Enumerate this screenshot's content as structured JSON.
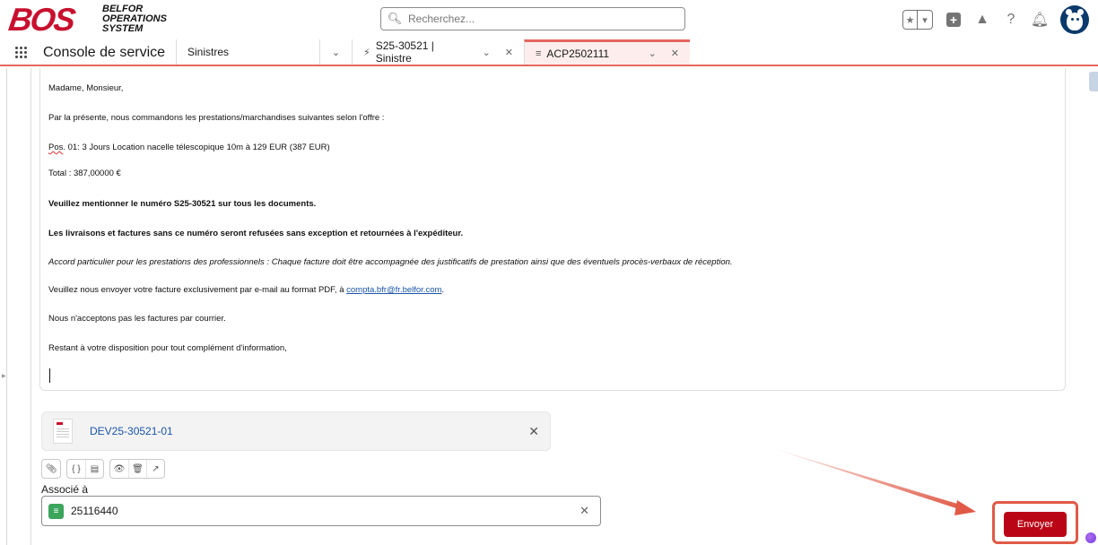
{
  "header": {
    "logo_mark": "BOS",
    "logo_text_lines": [
      "BELFOR",
      "OPERATIONS",
      "SYSTEM"
    ],
    "search_placeholder": "Recherchez...",
    "icons": [
      "favorites-icon",
      "favorites-dropdown-icon",
      "global-actions-icon",
      "trailhead-icon",
      "help-icon",
      "notifications-icon",
      "avatar"
    ]
  },
  "nav": {
    "app_name": "Console de service",
    "object_menu": "Sinistres",
    "tabs": [
      {
        "label": "S25-30521 | Sinistre",
        "icon": "lightning-icon"
      },
      {
        "label": "ACP2502111",
        "icon": "list-icon",
        "active": true
      }
    ]
  },
  "email": {
    "greeting": "Madame, Monsieur,",
    "intro": "Par la présente, nous commandons les prestations/marchandises suivantes selon l'offre :",
    "position_prefix": "Pos",
    "position_rest": ". 01: 3 Jours Location nacelle télescopique 10m à 129 EUR (387 EUR)",
    "total": "Total : 387,00000 €",
    "mention": "Veuillez mentionner le numéro S25-30521 sur tous les documents.",
    "refusal": "Les livraisons et factures sans ce numéro seront refusées sans exception et retournées à l'expéditeur.",
    "accord": "Accord particulier pour les prestations des professionnels : Chaque facture doit être accompagnée des justificatifs de prestation ainsi que des éventuels procès-verbaux de réception.",
    "invoice_prefix": "Veuillez nous envoyer votre facture exclusivement par e-mail au format PDF, à ",
    "invoice_email": "compta.bfr@fr.belfor.com",
    "invoice_suffix": ".",
    "no_mail": "Nous n'acceptons pas les factures par courrier.",
    "closing": "Restant à votre disposition pour tout complément d'information,"
  },
  "attachment": {
    "name": "DEV25-30521-01"
  },
  "toolbar": {
    "icons": [
      "attach-icon",
      "merge-field-icon",
      "template-icon",
      "preview-icon",
      "delete-icon",
      "popout-icon"
    ]
  },
  "associated": {
    "label": "Associé à",
    "value": "25116440"
  },
  "actions": {
    "send_label": "Envoyer"
  },
  "colors": {
    "brand_red": "#c8102e",
    "send_button": "#ba0517",
    "annotation": "#e05a47",
    "link": "#1a55a8"
  }
}
